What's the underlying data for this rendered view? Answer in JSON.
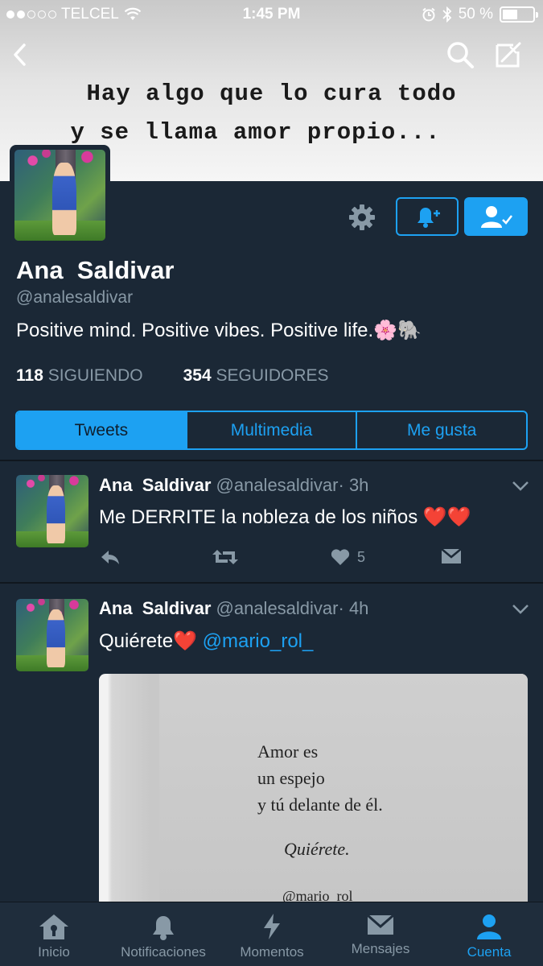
{
  "status_bar": {
    "carrier": "TELCEL",
    "time": "1:45 PM",
    "battery": "50 %",
    "battery_level": 0.5
  },
  "banner": {
    "line1": "Hay algo que lo cura todo",
    "line2": "y se llama amor propio..."
  },
  "profile": {
    "name": "Ana  Saldivar",
    "handle": "@analesaldivar",
    "bio": "Positive mind. Positive vibes. Positive life.🌸🐘",
    "following_count": "118",
    "following_label": "SIGUIENDO",
    "followers_count": "354",
    "followers_label": "SEGUIDORES"
  },
  "tabs": [
    {
      "label": "Tweets",
      "active": true
    },
    {
      "label": "Multimedia",
      "active": false
    },
    {
      "label": "Me gusta",
      "active": false
    }
  ],
  "tweets": [
    {
      "name": "Ana  Saldivar",
      "handle": "@analesaldivar",
      "time": "· 3h",
      "text": "Me DERRITE la nobleza de los niños ❤️❤️",
      "likes": "5"
    },
    {
      "name": "Ana  Saldivar",
      "handle": "@analesaldivar",
      "time": "· 4h",
      "text": "Quiérete❤️",
      "mention": "@mario_rol_",
      "image_text": [
        "Amor es",
        "un espejo",
        "y tú delante de él.",
        "Quiérete.",
        "@mario_rol"
      ]
    }
  ],
  "bottom_nav": [
    {
      "label": "Inicio",
      "icon": "home-icon"
    },
    {
      "label": "Notificaciones",
      "icon": "bell-icon"
    },
    {
      "label": "Momentos",
      "icon": "lightning-icon"
    },
    {
      "label": "Mensajes",
      "icon": "envelope-icon"
    },
    {
      "label": "Cuenta",
      "icon": "person-icon",
      "active": true
    }
  ],
  "colors": {
    "background": "#1b2836",
    "accent": "#1da1f2",
    "muted": "#8899a6"
  }
}
